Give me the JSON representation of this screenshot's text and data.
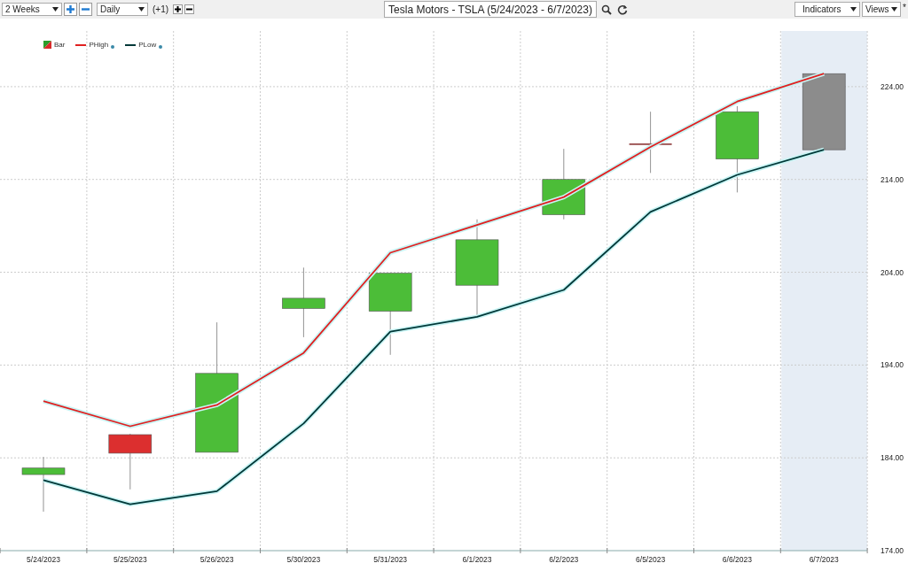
{
  "toolbar": {
    "range": "2 Weeks",
    "interval": "Daily",
    "offset": "(+1)",
    "title": "Tesla Motors - TSLA (5/24/2023 - 6/7/2023)",
    "indicators": "Indicators",
    "views": "Views",
    "modified_mark": "*"
  },
  "chart": {
    "bar_legend": "Bar",
    "bars": [
      {
        "color": "#4cbd38"
      },
      {
        "color": "#dc2f2f"
      },
      {
        "color": "#4cbd38"
      },
      {
        "color": "#4cbd38"
      },
      {
        "color": "#4cbd38"
      },
      {
        "color": "#4cbd38"
      },
      {
        "color": "#4cbd38"
      },
      {
        "color": "#a05a5a"
      },
      {
        "color": "#4cbd38"
      },
      {
        "color": "#8c8c8c"
      }
    ],
    "chart_data": {
      "type": "line",
      "grid": true,
      "categories": [
        "5/24/2023",
        "5/25/2023",
        "5/26/2023",
        "5/30/2023",
        "5/31/2023",
        "6/1/2023",
        "6/2/2023",
        "6/5/2023",
        "6/6/2023",
        "6/7/2023"
      ],
      "series": [
        {
          "name": "PHigh",
          "color": "#e02020",
          "values": [
            190.1,
            187.4,
            189.7,
            195.3,
            206.1,
            209.1,
            212.1,
            217.5,
            222.4,
            225.4
          ]
        },
        {
          "name": "PLow",
          "color": "#003838",
          "values": [
            181.6,
            179.0,
            180.4,
            187.7,
            197.6,
            199.2,
            202.1,
            210.5,
            214.5,
            217.2
          ]
        }
      ],
      "bands": [
        {
          "axis": "x",
          "from": "6/7/2023",
          "to": "6/7/2023",
          "color": "#e6edf5"
        }
      ],
      "ylim": [
        174,
        230
      ],
      "yticks": [
        {
          "value": 174,
          "label": "174.00"
        },
        {
          "value": 184,
          "label": "184.00"
        },
        {
          "value": 194,
          "label": "194.00"
        },
        {
          "value": 204,
          "label": "204.00"
        },
        {
          "value": 214,
          "label": "214.00"
        },
        {
          "value": 224,
          "label": "224.00"
        }
      ]
    }
  }
}
